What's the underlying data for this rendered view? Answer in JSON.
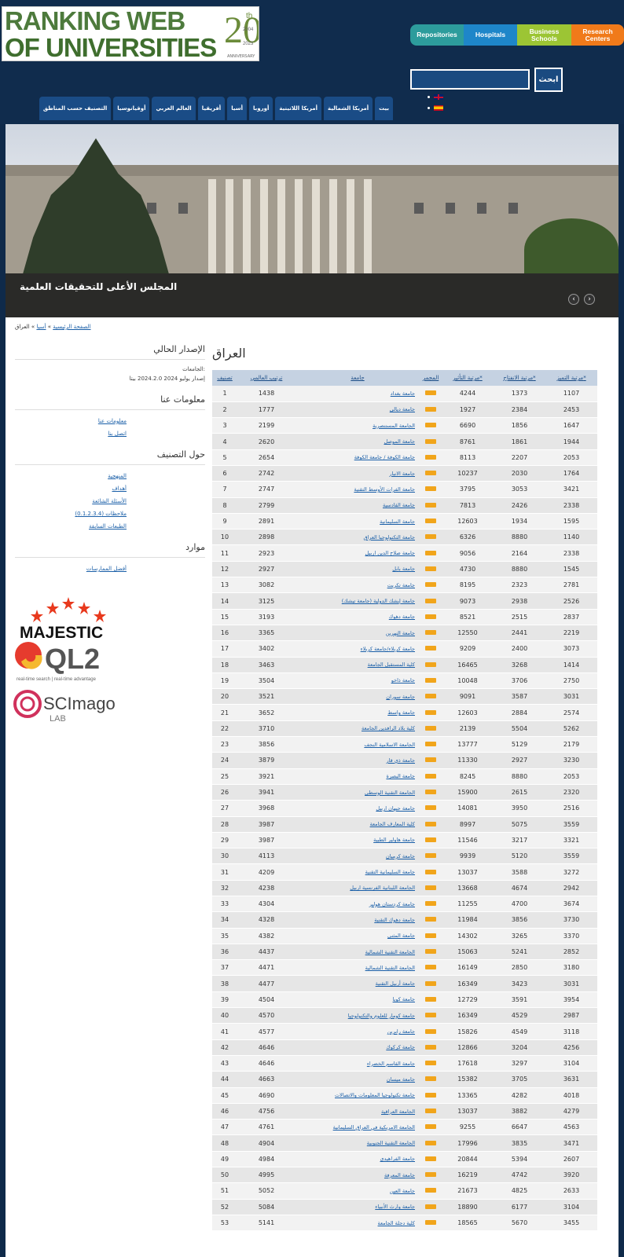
{
  "logo": {
    "line1": "RANKING WEB",
    "line2": "OF UNIVERSITIES",
    "num": "20",
    "suffix": "th",
    "year1": "2004",
    "year2": "2023",
    "anniv": "ANNIVERSARY"
  },
  "top_buttons": [
    "Repositories",
    "Hospitals",
    "Business Schools",
    "Research Centers"
  ],
  "search": {
    "placeholder": "",
    "button": "ابحث"
  },
  "nav": [
    "بيت",
    "أمريكا الشمالية",
    "أمريكا اللاتينية",
    "أوروبا",
    "أسيا",
    "أفريقيا",
    "العالم العربي",
    "أوقيانوسيا",
    "التصنيف حسب المناطق"
  ],
  "hero": {
    "caption": "المجلس الأعلى للتحقيقات العلمية"
  },
  "breadcrumb": {
    "home": "الصفحة الرئيسية",
    "asia": "أسيا",
    "current": "العراق"
  },
  "sidebar": {
    "current_title": "الإصدار الحالي",
    "universities_label": "الجامعات:",
    "version_text": "إصدار يوليو 2024 2024.2.0 بيتا",
    "about_title": "معلومات عنا",
    "about_links": [
      "معلومات عنا",
      "اتصل بنا"
    ],
    "ranking_title": "حول التصنيف",
    "ranking_links": [
      "المنهجية",
      "أهداف",
      "الأسئلة الشائعة",
      "ملاحظات (0.1.2.3.4)",
      "الطبعات السابقة"
    ],
    "resources_title": "موارد",
    "resources_links": [
      "أفضل الممارسات"
    ],
    "partner_logos": [
      "MAJESTIC",
      "QL2",
      "SCImago"
    ],
    "ql2_sub": "real-time search | real-time advantage",
    "scimago_sub": "LAB"
  },
  "page_title": "العراق",
  "table": {
    "headers": [
      "تصنيف",
      "ترتيب العالمي",
      "جامعة",
      "المجمر",
      "مرتبة التأثير*",
      "مرتبة الانفتاح*",
      "مرتبة التميز*"
    ],
    "rows": [
      [
        "1",
        "1438",
        "جامعة بغداد",
        "4244",
        "1373",
        "1107"
      ],
      [
        "2",
        "1777",
        "جامعة ديالى",
        "1927",
        "2384",
        "2453"
      ],
      [
        "3",
        "2199",
        "الجامعة المستنصرية",
        "6690",
        "1856",
        "1647"
      ],
      [
        "4",
        "2620",
        "جامعة الموصل",
        "8761",
        "1861",
        "1944"
      ],
      [
        "5",
        "2654",
        "جامعة الكوفة / جامعة الكوفة",
        "8113",
        "2207",
        "2053"
      ],
      [
        "6",
        "2742",
        "جامعة الانبار",
        "10237",
        "2030",
        "1764"
      ],
      [
        "7",
        "2747",
        "جامعة الفرات الأوسط التقنية",
        "3795",
        "3053",
        "3421"
      ],
      [
        "8",
        "2799",
        "جامعة القادسية",
        "7813",
        "2426",
        "2338"
      ],
      [
        "9",
        "2891",
        "جامعة السليمانية",
        "12603",
        "1934",
        "1595"
      ],
      [
        "10",
        "2898",
        "جامعة التكنولوجيا العراق",
        "6326",
        "8880",
        "1140"
      ],
      [
        "11",
        "2923",
        "جامعة صلاح الدين اربيل",
        "9056",
        "2164",
        "2338"
      ],
      [
        "12",
        "2927",
        "جامعة بابل",
        "4730",
        "8880",
        "1545"
      ],
      [
        "13",
        "3082",
        "جامعة تكريت",
        "8195",
        "2323",
        "2781"
      ],
      [
        "14",
        "3125",
        "جامعة إيشك الدولية (جامعة تيشك)",
        "9073",
        "2938",
        "2526"
      ],
      [
        "15",
        "3193",
        "جامعة دهوك",
        "8521",
        "2515",
        "2837"
      ],
      [
        "16",
        "3365",
        "جامعة النهرين",
        "12550",
        "2441",
        "2219"
      ],
      [
        "17",
        "3402",
        "جامعة كربلاء/جامعة كربلاء",
        "9209",
        "2400",
        "3073"
      ],
      [
        "18",
        "3463",
        "كلية المستقبل الجامعة",
        "16465",
        "3268",
        "1414"
      ],
      [
        "19",
        "3504",
        "جامعة ذاخو",
        "10048",
        "3706",
        "2750"
      ],
      [
        "20",
        "3521",
        "جامعة سوران",
        "9091",
        "3587",
        "3031"
      ],
      [
        "21",
        "3652",
        "جامعة واسط",
        "12603",
        "2884",
        "2574"
      ],
      [
        "22",
        "3710",
        "كلية بلاد الرافدين الجامعة",
        "2139",
        "5504",
        "5262"
      ],
      [
        "23",
        "3856",
        "الجامعة الاسلامية النجف",
        "13777",
        "5129",
        "2179"
      ],
      [
        "24",
        "3879",
        "جامعة ذي قار",
        "11330",
        "2927",
        "3230"
      ],
      [
        "25",
        "3921",
        "جامعة البصرة",
        "8245",
        "8880",
        "2053"
      ],
      [
        "26",
        "3941",
        "الجامعة التقنية الوسطى",
        "15900",
        "2615",
        "2320"
      ],
      [
        "27",
        "3968",
        "جامعة جيهان اربيل",
        "14081",
        "3950",
        "2516"
      ],
      [
        "28",
        "3987",
        "كلية المعارف الجامعة",
        "8997",
        "5075",
        "3559"
      ],
      [
        "29",
        "3987",
        "جامعة هاولير الطبية",
        "11546",
        "3217",
        "3321"
      ],
      [
        "30",
        "4113",
        "جامعة كرميان",
        "9939",
        "5120",
        "3559"
      ],
      [
        "31",
        "4209",
        "جامعة السليمانية التقنية",
        "13037",
        "3588",
        "3272"
      ],
      [
        "32",
        "4238",
        "الجامعة اللبنانية الفرنسية اربيل",
        "13668",
        "4674",
        "2942"
      ],
      [
        "33",
        "4304",
        "جامعة كردستان هولير",
        "11255",
        "4700",
        "3674"
      ],
      [
        "34",
        "4328",
        "جامعة دهوك التقنية",
        "11984",
        "3856",
        "3730"
      ],
      [
        "35",
        "4382",
        "جامعة المثنى",
        "14302",
        "3265",
        "3370"
      ],
      [
        "36",
        "4437",
        "الجامعة التقنية الشمالية",
        "15063",
        "5241",
        "2852"
      ],
      [
        "37",
        "4471",
        "الجامعة التقنية الشمالية",
        "16149",
        "2850",
        "3180"
      ],
      [
        "38",
        "4477",
        "جامعة أربيل التقنية",
        "16349",
        "3423",
        "3031"
      ],
      [
        "39",
        "4504",
        "جامعة كويا",
        "12729",
        "3591",
        "3954"
      ],
      [
        "40",
        "4570",
        "جامعة كومار للعلوم والتكنولوجيا",
        "16349",
        "4529",
        "2987"
      ],
      [
        "41",
        "4577",
        "جامعة رابرين",
        "15826",
        "4549",
        "3118"
      ],
      [
        "42",
        "4646",
        "جامعة كركوك",
        "12866",
        "3204",
        "4256"
      ],
      [
        "43",
        "4646",
        "جامعة القاسم الخضراء",
        "17618",
        "3297",
        "3104"
      ],
      [
        "44",
        "4663",
        "جامعة ميسان",
        "15382",
        "3705",
        "3631"
      ],
      [
        "45",
        "4690",
        "جامعة تكنولوجيا المعلومات والاتصالات",
        "13365",
        "4282",
        "4018"
      ],
      [
        "46",
        "4756",
        "الجامعة العراقية",
        "13037",
        "3882",
        "4279"
      ],
      [
        "47",
        "4761",
        "الجامعة الامريكية في العراق السليمانية",
        "9255",
        "6647",
        "4563"
      ],
      [
        "48",
        "4904",
        "الجامعة التقنية الجنوبية",
        "17996",
        "3835",
        "3471"
      ],
      [
        "49",
        "4984",
        "جامعة الفراهيدي",
        "20844",
        "5394",
        "2607"
      ],
      [
        "50",
        "4995",
        "جامعة المعرفة",
        "16219",
        "4742",
        "3920"
      ],
      [
        "51",
        "5052",
        "جامعة العين",
        "21673",
        "4825",
        "2633"
      ],
      [
        "52",
        "5084",
        "جامعة وارث الأنبياء",
        "18890",
        "6177",
        "3104"
      ],
      [
        "53",
        "5141",
        "كلية دجلة الجامعة",
        "18565",
        "5670",
        "3455"
      ]
    ]
  },
  "colors": {
    "header_bg": "#102c4d",
    "nav_bg": "#1a4c86",
    "table_header": "#c5d2e2",
    "detail_badge": "#f1a51b",
    "link": "#1a5fa8"
  }
}
